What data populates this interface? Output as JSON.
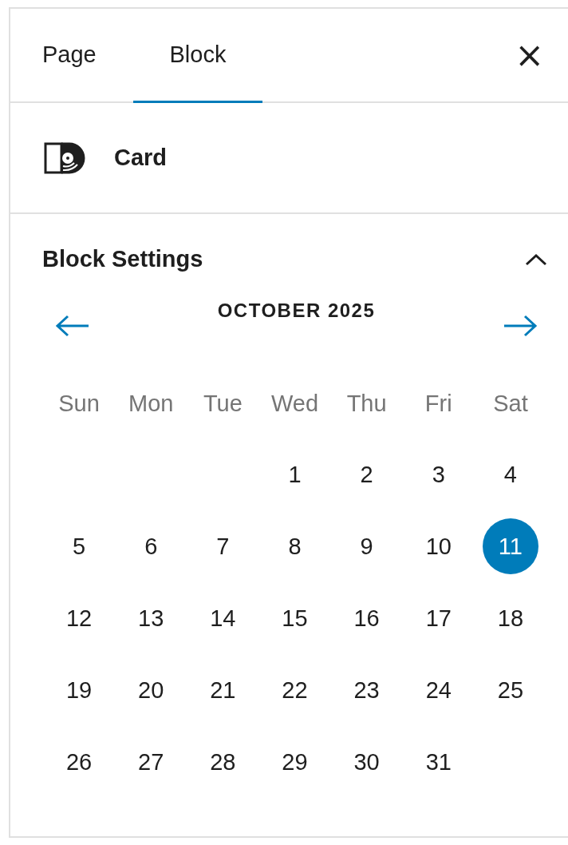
{
  "tabs": [
    {
      "label": "Page",
      "selected": false
    },
    {
      "label": "Block",
      "selected": true
    }
  ],
  "close": {
    "label": "×"
  },
  "block": {
    "name": "Card"
  },
  "panel": {
    "title": "Block Settings",
    "expanded": true
  },
  "calendar": {
    "month": "OCTOBER 2025",
    "weekdays": [
      "Sun",
      "Mon",
      "Tue",
      "Wed",
      "Thu",
      "Fri",
      "Sat"
    ],
    "weeks": [
      [
        {
          "kind": "blank"
        },
        {
          "kind": "blank"
        },
        {
          "kind": "blank"
        },
        {
          "kind": "day",
          "label": "1",
          "selected": false
        },
        {
          "kind": "day",
          "label": "2",
          "selected": false
        },
        {
          "kind": "day",
          "label": "3",
          "selected": false
        },
        {
          "kind": "day",
          "label": "4",
          "selected": false
        }
      ],
      [
        {
          "kind": "day",
          "label": "5",
          "selected": false
        },
        {
          "kind": "day",
          "label": "6",
          "selected": false
        },
        {
          "kind": "day",
          "label": "7",
          "selected": false
        },
        {
          "kind": "day",
          "label": "8",
          "selected": false
        },
        {
          "kind": "day",
          "label": "9",
          "selected": false
        },
        {
          "kind": "day",
          "label": "10",
          "selected": false
        },
        {
          "kind": "day",
          "label": "11",
          "selected": true
        }
      ],
      [
        {
          "kind": "day",
          "label": "12",
          "selected": false
        },
        {
          "kind": "day",
          "label": "13",
          "selected": false
        },
        {
          "kind": "day",
          "label": "14",
          "selected": false
        },
        {
          "kind": "day",
          "label": "15",
          "selected": false
        },
        {
          "kind": "day",
          "label": "16",
          "selected": false
        },
        {
          "kind": "day",
          "label": "17",
          "selected": false
        },
        {
          "kind": "day",
          "label": "18",
          "selected": false
        }
      ],
      [
        {
          "kind": "day",
          "label": "19",
          "selected": false
        },
        {
          "kind": "day",
          "label": "20",
          "selected": false
        },
        {
          "kind": "day",
          "label": "21",
          "selected": false
        },
        {
          "kind": "day",
          "label": "22",
          "selected": false
        },
        {
          "kind": "day",
          "label": "23",
          "selected": false
        },
        {
          "kind": "day",
          "label": "24",
          "selected": false
        },
        {
          "kind": "day",
          "label": "25",
          "selected": false
        }
      ],
      [
        {
          "kind": "day",
          "label": "26",
          "selected": false
        },
        {
          "kind": "day",
          "label": "27",
          "selected": false
        },
        {
          "kind": "day",
          "label": "28",
          "selected": false
        },
        {
          "kind": "day",
          "label": "29",
          "selected": false
        },
        {
          "kind": "day",
          "label": "30",
          "selected": false
        },
        {
          "kind": "day",
          "label": "31",
          "selected": false
        },
        {
          "kind": "blank"
        }
      ]
    ]
  }
}
